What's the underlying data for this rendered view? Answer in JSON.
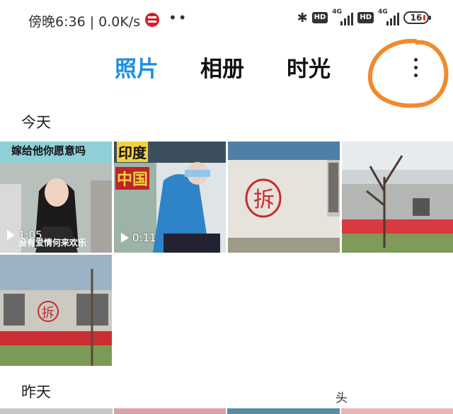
{
  "status_bar": {
    "time_speed": "傍晚6:36 | 0.0K/s",
    "carrier_logo": "china-mobile-icon",
    "dots": "••",
    "hd1": "HD",
    "net1": "4G",
    "hd2": "HD",
    "net2": "4G",
    "battery": "16"
  },
  "tabs": [
    {
      "label": "照片",
      "active": true
    },
    {
      "label": "相册",
      "active": false
    },
    {
      "label": "时光",
      "active": false
    }
  ],
  "more_menu": {
    "icon": "more-vertical-icon",
    "annotation_color": "#f08a2d"
  },
  "sections": [
    {
      "title": "今天",
      "items": [
        {
          "type": "video",
          "caption_top": "嫁给他你愿意吗",
          "caption_bottom": "没有爱情何来欢乐",
          "duration": "1:05"
        },
        {
          "type": "video",
          "caption_top": "印度",
          "caption_mid": "中国",
          "duration": "0:11"
        },
        {
          "type": "photo",
          "subject": "拆",
          "description_text": ""
        },
        {
          "type": "photo"
        },
        {
          "type": "photo",
          "subject": "拆"
        }
      ]
    },
    {
      "title": "昨天",
      "items": []
    }
  ],
  "watermark": "头",
  "colors": {
    "accent": "#1a8fe3",
    "text": "#111111"
  }
}
